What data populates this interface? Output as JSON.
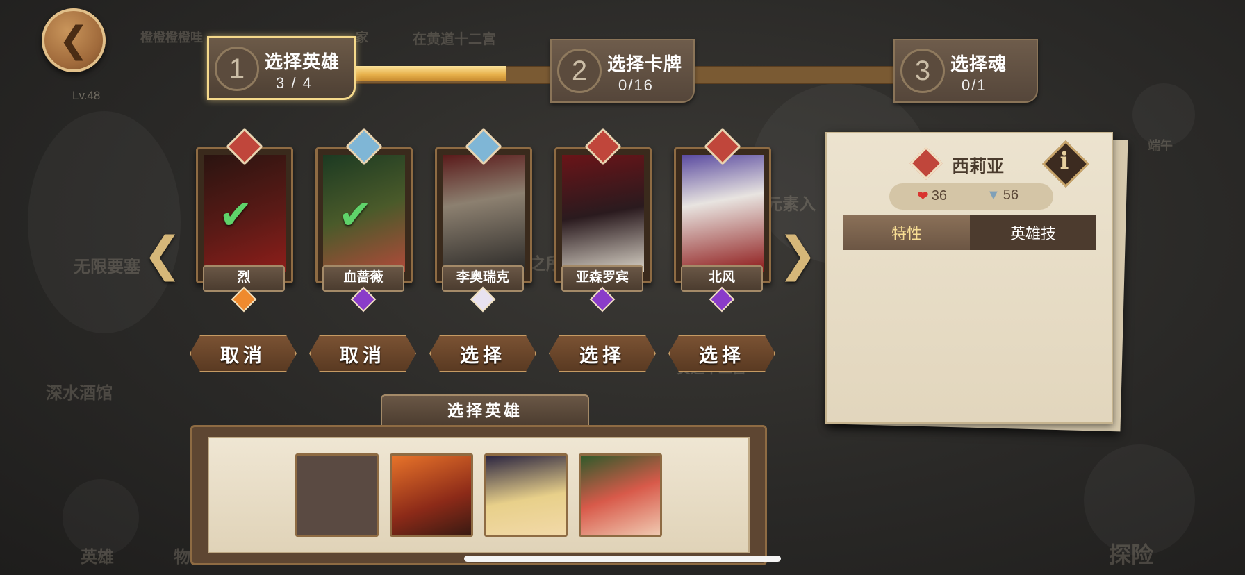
{
  "background_labels": {
    "player_name": "橙橙橙橙哇",
    "banner_text": "在黄道十二宫",
    "banner_prefix": "家",
    "level": "Lv.48",
    "area_1": "无限要塞",
    "area_2": "深水酒馆",
    "area_3": "元素入",
    "area_4": "之所",
    "area_5": "黄道十二宫",
    "nav_hero": "英雄",
    "nav_item": "物",
    "nav_explore": "探险",
    "event": "端午"
  },
  "steps": [
    {
      "num": "1",
      "title": "选择英雄",
      "count": "3 / 4"
    },
    {
      "num": "2",
      "title": "选择卡牌",
      "count": "0/16"
    },
    {
      "num": "3",
      "title": "选择魂",
      "count": "0/1"
    }
  ],
  "progress": {
    "step_1_fill_fraction": 1.0,
    "overall_fraction": 0.3
  },
  "heroes": [
    {
      "name": "烈",
      "button": "取消",
      "selected": true,
      "class_badge": "sword",
      "gem": "orange"
    },
    {
      "name": "血蔷薇",
      "button": "取消",
      "selected": true,
      "class_badge": "shield",
      "gem": "purple"
    },
    {
      "name": "李奥瑞克",
      "button": "选择",
      "selected": false,
      "class_badge": "shield",
      "gem": "white"
    },
    {
      "name": "亚森罗宾",
      "button": "选择",
      "selected": false,
      "class_badge": "sword",
      "gem": "purple"
    },
    {
      "name": "北风",
      "button": "选择",
      "selected": false,
      "class_badge": "sword",
      "gem": "purple"
    }
  ],
  "tray": {
    "title": "选择英雄"
  },
  "detail": {
    "name": "西莉亚",
    "hp": "36",
    "stat2": "56",
    "info_glyph": "i",
    "tabs": [
      "特性",
      "英雄技"
    ]
  },
  "colors": {
    "accent_gold": "#f5d98b",
    "badge_red": "#c0463b",
    "badge_blue": "#7fb6d6",
    "check_green": "#5fd36a"
  }
}
